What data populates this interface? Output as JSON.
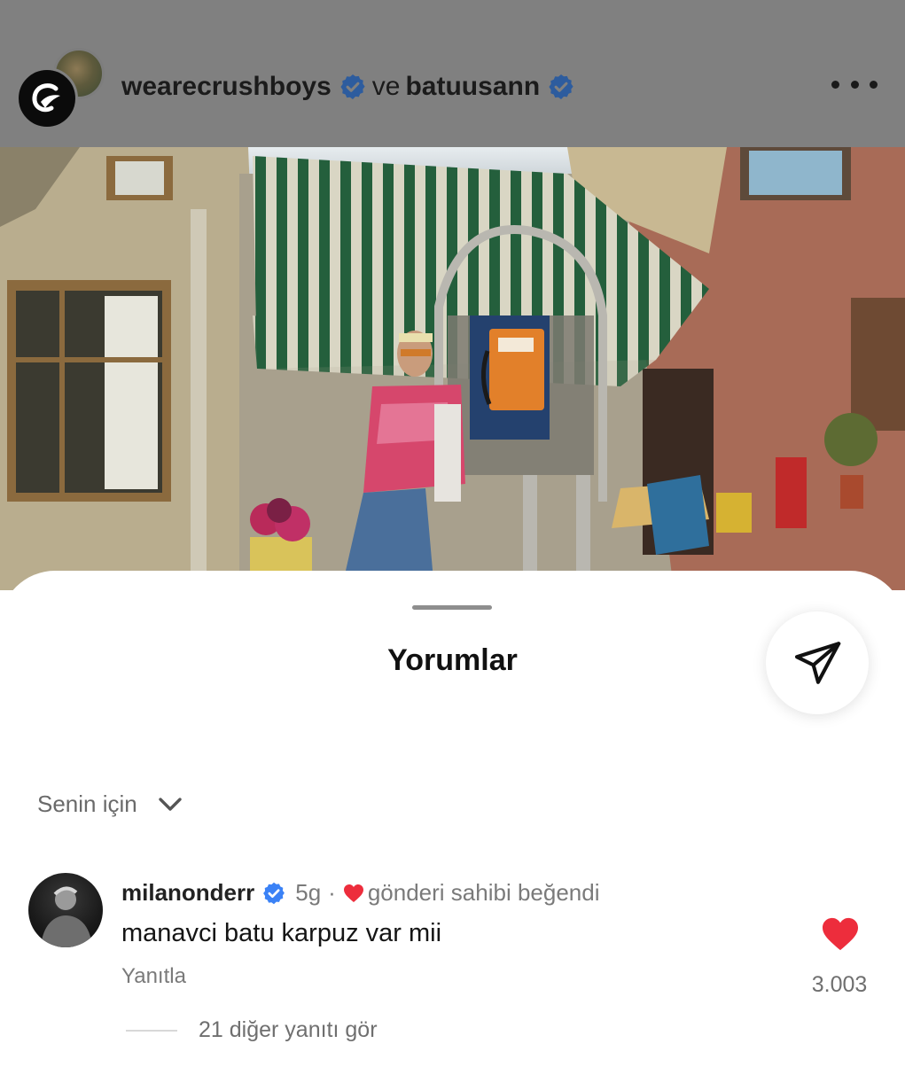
{
  "post": {
    "author_primary": "wearecrushboys",
    "conjunction": "ve",
    "author_secondary": "batuusann"
  },
  "sheet": {
    "title": "Yorumlar"
  },
  "sort": {
    "label": "Senin için"
  },
  "comment": {
    "username": "milanonderr",
    "time": "5g",
    "separator": "·",
    "liked_by_author": "gönderi sahibi beğendi",
    "text": "manavci batu karpuz var mii",
    "reply_label": "Yanıtla",
    "like_count": "3.003",
    "more_replies": "21 diğer yanıtı gör"
  },
  "icons": {
    "verified": "verified-badge-icon",
    "more": "more-options-icon",
    "share": "send-icon",
    "chevron": "chevron-down-icon",
    "heart": "heart-icon"
  },
  "colors": {
    "verified": "#3b82f6",
    "heart": "#ed2d3c",
    "dim_overlay": "#808080"
  }
}
